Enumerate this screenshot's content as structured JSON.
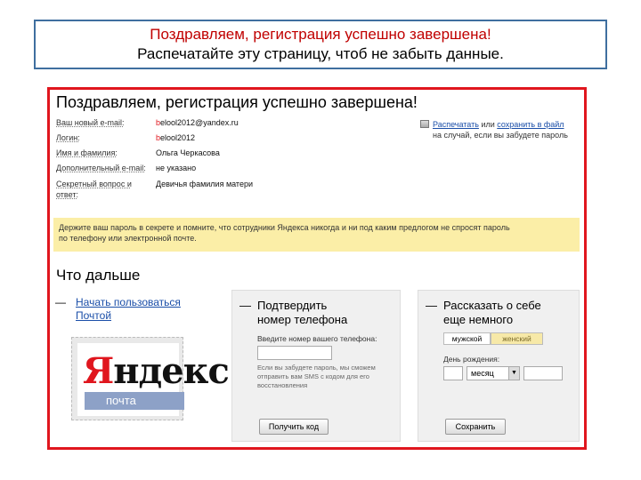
{
  "caption": {
    "line1": "Поздравляем, регистрация успешно завершена!",
    "line2": "Распечатайте эту страницу, чтоб не забыть данные."
  },
  "headline": "Поздравляем, регистрация успешно завершена!",
  "info": {
    "rows": [
      {
        "label": "Ваш новый e-mail:",
        "value": "belool2012@yandex.ru"
      },
      {
        "label": "Логин:",
        "value": "belool2012"
      },
      {
        "label": "Имя и фамилия:",
        "value": "Ольга Черкасова"
      },
      {
        "label": "Дополнительный e-mail:",
        "value": "не указано"
      },
      {
        "label": "Секретный вопрос и ответ:",
        "value": "Девичья фамилия матери"
      }
    ]
  },
  "print": {
    "link_print": "Распечатать",
    "or": " или ",
    "link_save": "сохранить в файл",
    "note": "на случай, если вы забудете пароль"
  },
  "notice": {
    "line1": "Держите ваш пароль в секрете и помните, что сотрудники Яндекса никогда и ни под каким предлогом не спросят пароль",
    "line2": "по телефону или электронной почте."
  },
  "next_title": "Что дальше",
  "col1": {
    "dash": "—",
    "link_line1": "Начать пользоваться",
    "link_line2": "Почтой",
    "logo_word": "Яндекс",
    "logo_sub": "почта"
  },
  "phone": {
    "dash": "—",
    "title_line1": "Подтвердить",
    "title_line2": "номер телефона",
    "input_label": "Введите номер вашего телефона:",
    "hint": "Если вы забудете пароль, мы сможем отправить вам SMS с кодом для его восстановления",
    "button": "Получить код"
  },
  "about": {
    "dash": "—",
    "title_line1": "Рассказать о себе",
    "title_line2": "еще немного",
    "gender_male": "мужской",
    "gender_female": "женский",
    "birthday_label": "День рождения:",
    "month_value": "месяц",
    "button": "Сохранить"
  }
}
